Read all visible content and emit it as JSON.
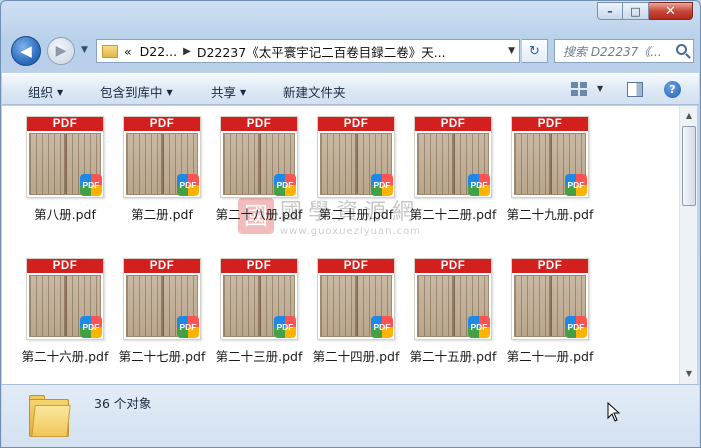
{
  "window": {
    "caption": {
      "minimize": "–",
      "maximize": "□",
      "close": "✕"
    }
  },
  "nav": {
    "back_glyph": "◀",
    "forward_glyph": "▶",
    "dropdown_glyph": "▼",
    "breadcrumb": [
      "D22...",
      "D22237《太平寰宇记二百卷目録二卷》天..."
    ],
    "breadcrumb_overflow": "«",
    "refresh_glyph": "↻",
    "search_placeholder": "搜索 D22237《..."
  },
  "toolbar": {
    "organize": "组织",
    "include_in_library": "包含到库中",
    "share": "共享",
    "new_folder": "新建文件夹",
    "help_glyph": "?"
  },
  "files": [
    {
      "name": "第八册.pdf",
      "badge": "PDF",
      "band": "PDF"
    },
    {
      "name": "第二册.pdf",
      "badge": "PDF",
      "band": "PDF"
    },
    {
      "name": "第二十八册.pdf",
      "badge": "PDF",
      "band": "PDF"
    },
    {
      "name": "第二十册.pdf",
      "badge": "PDF",
      "band": "PDF"
    },
    {
      "name": "第二十二册.pdf",
      "badge": "PDF",
      "band": "PDF"
    },
    {
      "name": "第二十九册.pdf",
      "badge": "PDF",
      "band": "PDF"
    },
    {
      "name": "第二十六册.pdf",
      "badge": "PDF",
      "band": "PDF"
    },
    {
      "name": "第二十七册.pdf",
      "badge": "PDF",
      "band": "PDF"
    },
    {
      "name": "第二十三册.pdf",
      "badge": "PDF",
      "band": "PDF"
    },
    {
      "name": "第二十四册.pdf",
      "badge": "PDF",
      "band": "PDF"
    },
    {
      "name": "第二十五册.pdf",
      "badge": "PDF",
      "band": "PDF"
    },
    {
      "name": "第二十一册.pdf",
      "badge": "PDF",
      "band": "PDF"
    }
  ],
  "watermark": {
    "seal": "國",
    "text": "國學資源網",
    "url": "www.guoxueziyuan.com"
  },
  "status": {
    "count_text": "36 个对象"
  },
  "colors": {
    "pdf_red": "#d41f1f",
    "accent_blue": "#2f6fc0"
  }
}
